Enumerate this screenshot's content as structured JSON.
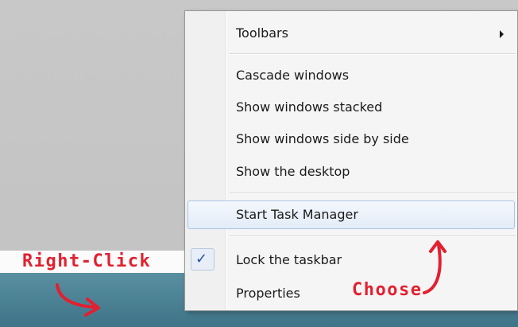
{
  "menu": {
    "items": [
      {
        "label": "Toolbars",
        "has_submenu": true
      },
      {
        "label": "Cascade windows"
      },
      {
        "label": "Show windows stacked"
      },
      {
        "label": "Show windows side by side"
      },
      {
        "label": "Show the desktop"
      },
      {
        "label": "Start Task Manager",
        "highlighted": true
      },
      {
        "label": "Lock the taskbar",
        "checked": true
      },
      {
        "label": "Properties"
      }
    ]
  },
  "annotations": {
    "right_click": "Right-Click",
    "choose": "Choose"
  },
  "icons": {
    "check": "check-icon",
    "submenu": "chevron-right-icon",
    "arrow": "curved-arrow-icon"
  },
  "colors": {
    "annotation": "#e22030",
    "taskbar": "#4f8596",
    "highlight_border": "#a9c3e3"
  }
}
